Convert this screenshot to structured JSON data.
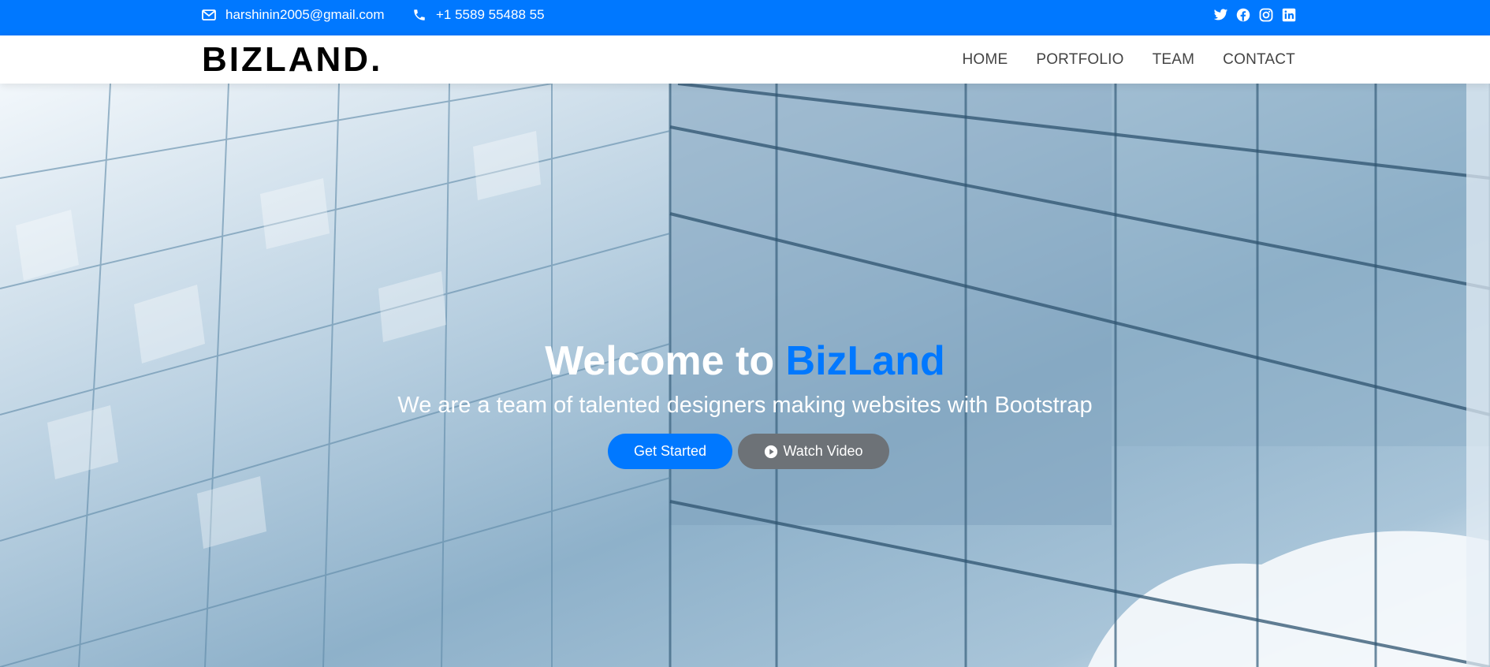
{
  "topbar": {
    "email": "harshinin2005@gmail.com",
    "phone": "+1 5589 55488 55",
    "social_icons": [
      "twitter-icon",
      "facebook-icon",
      "instagram-icon",
      "linkedin-icon"
    ]
  },
  "header": {
    "logo": "BIZLAND.",
    "nav": [
      "HOME",
      "PORTFOLIO",
      "TEAM",
      "CONTACT"
    ]
  },
  "hero": {
    "title_prefix": "Welcome to ",
    "title_accent": "BizLand",
    "subtitle": "We are a team of talented designers making websites with Bootstrap",
    "get_started": "Get Started",
    "watch_video": "Watch Video"
  },
  "colors": {
    "accent": "#0078ff",
    "secondary_button": "#6d7277",
    "nav_text": "#444444"
  }
}
